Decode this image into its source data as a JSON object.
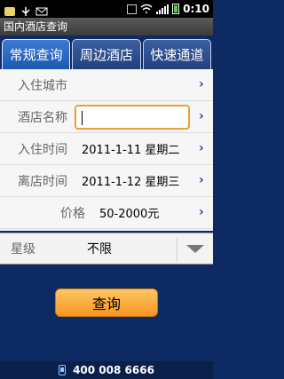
{
  "status_bar": {
    "time": "0:10",
    "icons": [
      "notification-icon",
      "usb-icon",
      "mail-icon",
      "vibrate-icon",
      "wifi-icon",
      "signal-icon",
      "battery-icon"
    ]
  },
  "window": {
    "title": "国内酒店查询"
  },
  "tabs": [
    {
      "label": "常规查询",
      "active": true
    },
    {
      "label": "周边酒店",
      "active": false
    },
    {
      "label": "快速通道",
      "active": false
    }
  ],
  "form": {
    "city": {
      "label": "入住城市",
      "value": ""
    },
    "hotel_name": {
      "label": "酒店名称",
      "value": ""
    },
    "checkin": {
      "label": "入住时间",
      "value": "2011-1-11 星期二"
    },
    "checkout": {
      "label": "离店时间",
      "value": "2011-1-12 星期三"
    },
    "price": {
      "label": "价格",
      "value": "50-2000元"
    }
  },
  "star_level": {
    "label": "星级",
    "value": "不限"
  },
  "search_button": {
    "label": "查询"
  },
  "footer": {
    "phone": "400 008 6666"
  },
  "colors": {
    "accent": "#f59421",
    "tab_active": "#1d58b2",
    "background": "#0e2a63"
  }
}
